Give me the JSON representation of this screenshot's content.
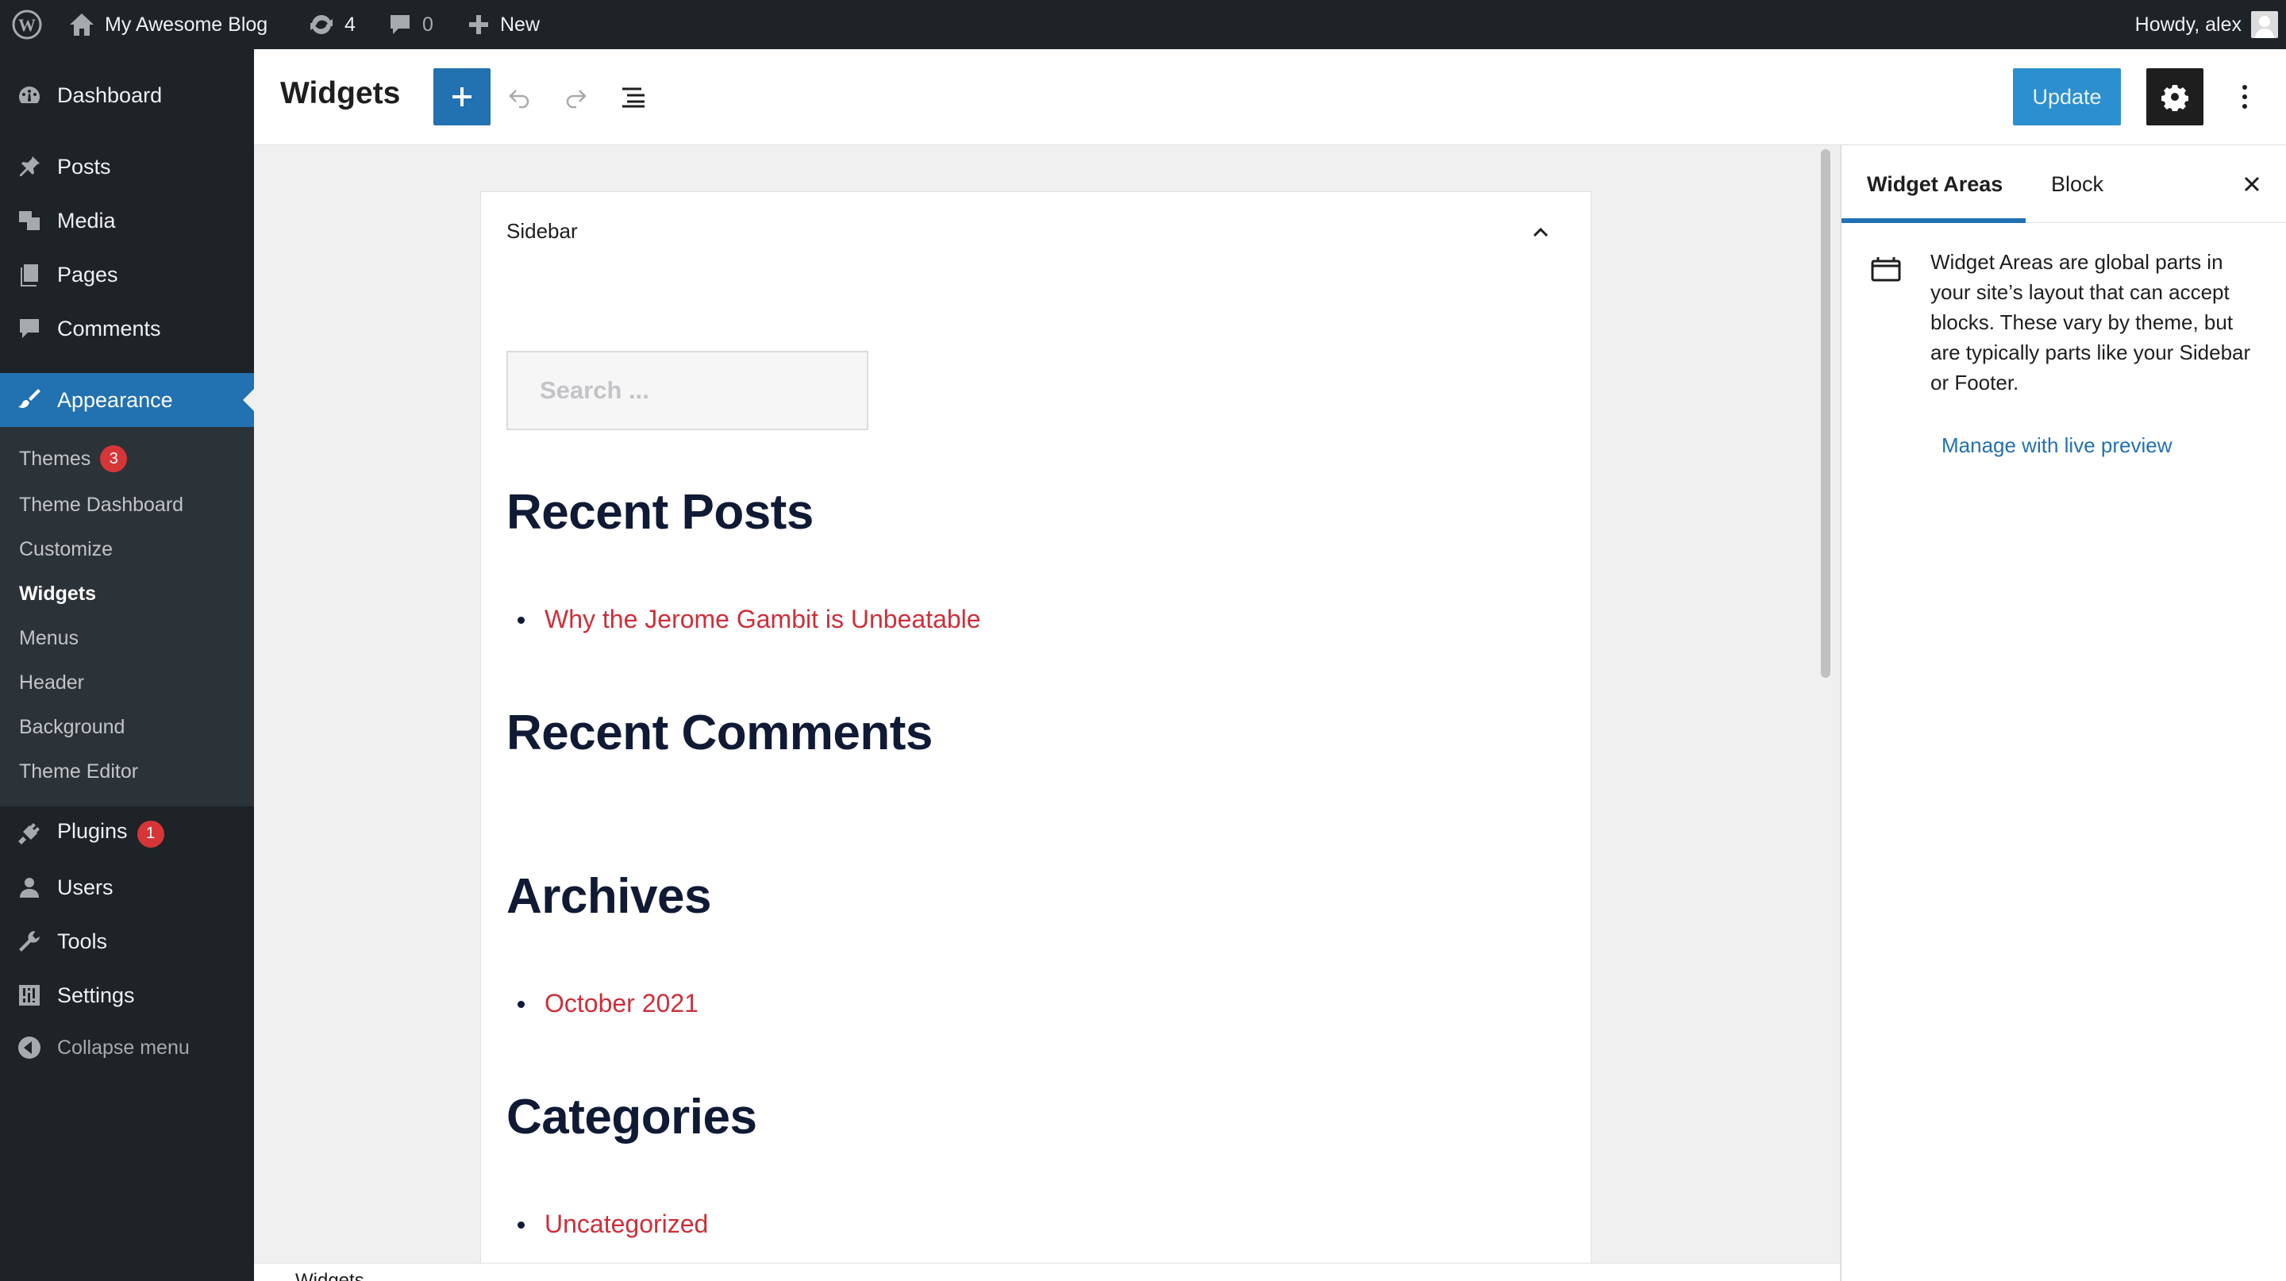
{
  "admin_bar": {
    "site_name": "My Awesome Blog",
    "updates_count": "4",
    "comments_count": "0",
    "new_label": "New",
    "howdy": "Howdy, alex"
  },
  "menu": {
    "dashboard": "Dashboard",
    "posts": "Posts",
    "media": "Media",
    "pages": "Pages",
    "comments": "Comments",
    "appearance": "Appearance",
    "plugins": "Plugins",
    "plugins_badge": "1",
    "users": "Users",
    "tools": "Tools",
    "settings": "Settings",
    "collapse": "Collapse menu"
  },
  "submenu": {
    "themes": "Themes",
    "themes_badge": "3",
    "theme_dashboard": "Theme Dashboard",
    "customize": "Customize",
    "widgets": "Widgets",
    "menus": "Menus",
    "header": "Header",
    "background": "Background",
    "theme_editor": "Theme Editor"
  },
  "editor": {
    "title": "Widgets",
    "update_label": "Update",
    "footer_breadcrumb": "Widgets"
  },
  "widget_area": {
    "title": "Sidebar",
    "search_placeholder": "Search ...",
    "recent_posts_heading": "Recent Posts",
    "recent_posts": [
      "Why the Jerome Gambit is Unbeatable"
    ],
    "recent_comments_heading": "Recent Comments",
    "archives_heading": "Archives",
    "archives": [
      "October 2021"
    ],
    "categories_heading": "Categories",
    "categories": [
      "Uncategorized"
    ]
  },
  "sidebar": {
    "tab_widget_areas": "Widget Areas",
    "tab_block": "Block",
    "description": "Widget Areas are global parts in your site’s layout that can accept blocks. These vary by theme, but are typically parts like your Sidebar or Footer.",
    "manage_link": "Manage with live preview"
  },
  "colors": {
    "admin_dark": "#1d2327",
    "accent_blue": "#2271b1",
    "badge_red": "#d63638",
    "link_red": "#cd2f3a",
    "heading_navy": "#101a35"
  }
}
